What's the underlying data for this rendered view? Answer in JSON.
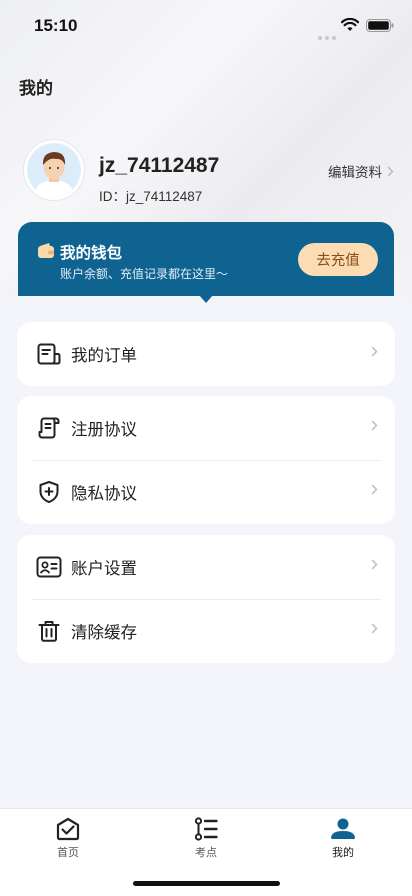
{
  "status_bar": {
    "time": "15:10"
  },
  "page": {
    "title": "我的"
  },
  "profile": {
    "username": "jz_74112487",
    "id_text": "ID：jz_74112487",
    "edit_label": "编辑资料"
  },
  "wallet": {
    "title": "我的钱包",
    "subtitle": "账户余额、充值记录都在这里～",
    "recharge_label": "去充值",
    "color": "#0e6391"
  },
  "menu": {
    "orders": "我的订单",
    "register_agreement": "注册协议",
    "privacy_agreement": "隐私协议",
    "account_settings": "账户设置",
    "clear_cache": "清除缓存"
  },
  "tabbar": {
    "tabs": [
      {
        "label": "首页",
        "icon": "home-check-icon"
      },
      {
        "label": "考点",
        "icon": "list-icon"
      },
      {
        "label": "我的",
        "icon": "user-icon",
        "active": true
      }
    ],
    "active_color": "#0e6391"
  }
}
